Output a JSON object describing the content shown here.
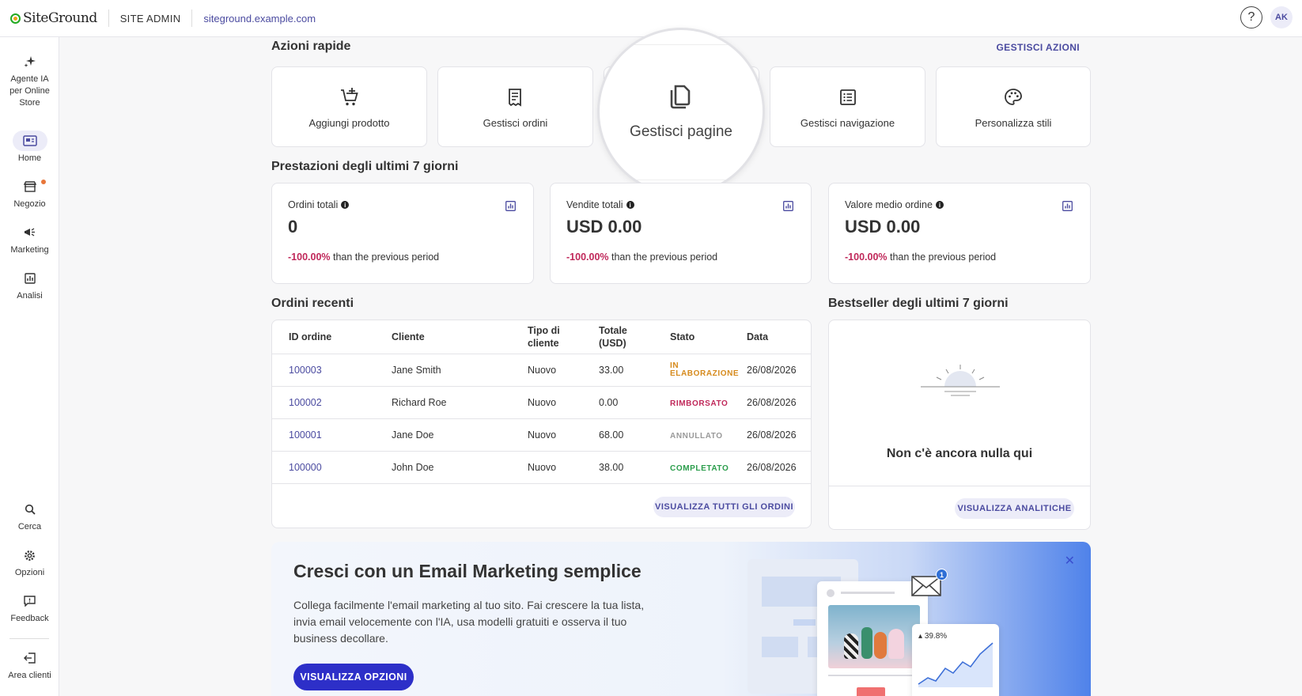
{
  "topbar": {
    "logo": "SiteGround",
    "section": "SITE ADMIN",
    "site_url": "siteground.example.com",
    "help": "?",
    "avatar_initials": "AK"
  },
  "sidebar": {
    "items": [
      {
        "label": "Agente IA per Online Store",
        "icon": "sparkle-icon"
      },
      {
        "label": "Home",
        "icon": "home-icon"
      },
      {
        "label": "Negozio",
        "icon": "store-icon"
      },
      {
        "label": "Marketing",
        "icon": "megaphone-icon"
      },
      {
        "label": "Analisi",
        "icon": "chart-icon"
      },
      {
        "label": "Cerca",
        "icon": "search-icon"
      },
      {
        "label": "Opzioni",
        "icon": "gear-icon"
      },
      {
        "label": "Feedback",
        "icon": "feedback-icon"
      },
      {
        "label": "Area clienti",
        "icon": "exit-icon"
      }
    ]
  },
  "quick_actions": {
    "title": "Azioni rapide",
    "manage_label": "GESTISCI AZIONI",
    "items": [
      {
        "label": "Aggiungi prodotto",
        "icon": "cart-add-icon"
      },
      {
        "label": "Gestisci ordini",
        "icon": "receipt-icon"
      },
      {
        "label": "Gestisci pagine",
        "icon": "pages-icon"
      },
      {
        "label": "Gestisci navigazione",
        "icon": "list-icon"
      },
      {
        "label": "Personalizza stili",
        "icon": "palette-icon"
      }
    ]
  },
  "performance": {
    "title": "Prestazioni degli ultimi 7 giorni",
    "cards": [
      {
        "label": "Ordini totali",
        "value": "0",
        "change": "-100.00%",
        "change_suffix": "than the previous period"
      },
      {
        "label": "Vendite totali",
        "value": "USD 0.00",
        "change": "-100.00%",
        "change_suffix": "than the previous period"
      },
      {
        "label": "Valore medio ordine",
        "value": "USD 0.00",
        "change": "-100.00%",
        "change_suffix": "than the previous period"
      }
    ]
  },
  "recent_orders": {
    "title": "Ordini recenti",
    "columns": [
      "ID ordine",
      "Cliente",
      "Tipo di cliente",
      "Totale (USD)",
      "Stato",
      "Data"
    ],
    "rows": [
      {
        "id": "100003",
        "customer": "Jane Smith",
        "type": "Nuovo",
        "total": "33.00",
        "status": "IN ELABORAZIONE",
        "status_color": "#d68a1c",
        "date": "26/08/2026"
      },
      {
        "id": "100002",
        "customer": "Richard Roe",
        "type": "Nuovo",
        "total": "0.00",
        "status": "RIMBORSATO",
        "status_color": "#c0285a",
        "date": "26/08/2026"
      },
      {
        "id": "100001",
        "customer": "Jane Doe",
        "type": "Nuovo",
        "total": "68.00",
        "status": "ANNULLATO",
        "status_color": "#999999",
        "date": "26/08/2026"
      },
      {
        "id": "100000",
        "customer": "John Doe",
        "type": "Nuovo",
        "total": "38.00",
        "status": "COMPLETATO",
        "status_color": "#2a9d4b",
        "date": "26/08/2026"
      }
    ],
    "view_all": "VISUALIZZA TUTTI GLI ORDINI"
  },
  "bestseller": {
    "title": "Bestseller degli ultimi 7 giorni",
    "empty_text": "Non c'è ancora nulla qui",
    "view_analytics": "VISUALIZZA ANALITICHE"
  },
  "promo": {
    "title": "Cresci con un Email Marketing semplice",
    "text": "Collega facilmente l'email marketing al tuo sito. Fai crescere la tua lista, invia email velocemente con l'IA, usa modelli gratuiti e osserva il tuo business decollare.",
    "button": "VISUALIZZA OPZIONI",
    "close": "✕",
    "badge": "1",
    "stat": "39.8%"
  },
  "colors": {
    "accent": "#4b4ba0",
    "primary_button": "#2d2fc8",
    "negative": "#c0285a"
  }
}
